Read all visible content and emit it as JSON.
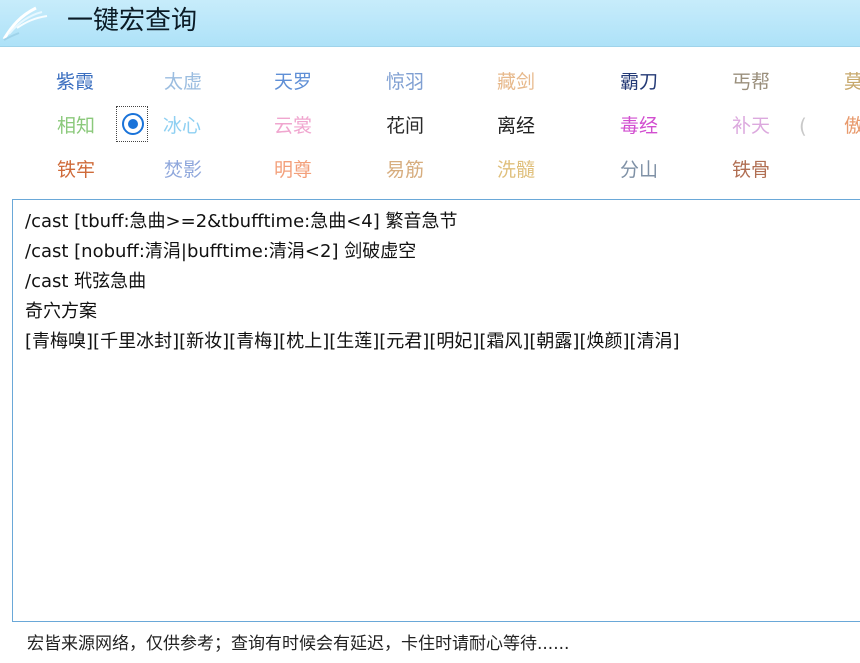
{
  "window": {
    "title": "一键宏查询"
  },
  "sects": [
    {
      "id": "ziqia",
      "label": "紫霞",
      "color": "#3b6fc0"
    },
    {
      "id": "taixu",
      "label": "太虚",
      "color": "#9bbde0"
    },
    {
      "id": "tianluo",
      "label": "天罗",
      "color": "#5f8fd6"
    },
    {
      "id": "jingyu",
      "label": "惊羽",
      "color": "#7f9fd2"
    },
    {
      "id": "cangjian",
      "label": "藏剑",
      "color": "#e7b98c"
    },
    {
      "id": "badao",
      "label": "霸刀",
      "color": "#243a76"
    },
    {
      "id": "gaibang",
      "label": "丐帮",
      "color": "#9a8f7c"
    },
    {
      "id": "mo",
      "label": "莫",
      "color": "#c7a86b"
    },
    {
      "id": "xiangzhi",
      "label": "相知",
      "color": "#8bc97b"
    },
    {
      "id": "bingxin",
      "label": "冰心",
      "color": "#8fd0f2"
    },
    {
      "id": "yunshang",
      "label": "云裳",
      "color": "#f0a6cf"
    },
    {
      "id": "huajian",
      "label": "花间",
      "color": "#2a2a2a"
    },
    {
      "id": "lijing",
      "label": "离经",
      "color": "#222222"
    },
    {
      "id": "dujing",
      "label": "毒经",
      "color": "#d24fd0"
    },
    {
      "id": "butian",
      "label": "补天",
      "color": "#dca9de"
    },
    {
      "id": "ao",
      "label": "傲",
      "color": "#e89a6d"
    },
    {
      "id": "tielao",
      "label": "铁牢",
      "color": "#cf6b3a"
    },
    {
      "id": "fenying",
      "label": "焚影",
      "color": "#90a8dc"
    },
    {
      "id": "mingzun",
      "label": "明尊",
      "color": "#f3a07b"
    },
    {
      "id": "yijin",
      "label": "易筋",
      "color": "#d7ad7e"
    },
    {
      "id": "xisui",
      "label": "洗髓",
      "color": "#e0c07d"
    },
    {
      "id": "fenshan",
      "label": "分山",
      "color": "#7f91a6"
    },
    {
      "id": "tiegu",
      "label": "铁骨",
      "color": "#b16f53"
    }
  ],
  "selected_sect": "冰心",
  "macro_lines": [
    "/cast [tbuff:急曲>=2&tbufftime:急曲<4] 繁音急节",
    "/cast [nobuff:清涓|bufftime:清涓<2] 剑破虚空",
    "/cast 玳弦急曲",
    "奇穴方案",
    "[青梅嗅][千里冰封][新妆][青梅][枕上][生莲][元君][明妃][霜风][朝露][焕颜][清涓]"
  ],
  "footer": {
    "notice": "宏皆来源网络，仅供参考；查询有时候会有延迟，卡住时请耐心等待......"
  },
  "colors": {
    "title_bar": "#b8e6f8",
    "accent": "#1a73d9",
    "border": "#6aa8d8"
  },
  "icons": {
    "app": "feather-icon"
  }
}
